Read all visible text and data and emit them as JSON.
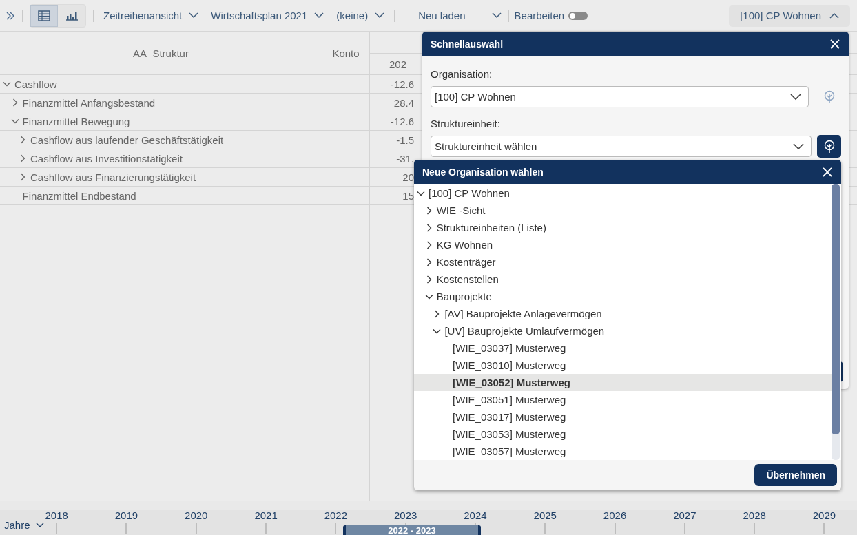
{
  "toolbar": {
    "view_toggles": [
      {
        "kind": "table",
        "selected": true
      },
      {
        "kind": "chart",
        "selected": false
      }
    ],
    "dropdowns": [
      {
        "label": "Zeitreihenansicht"
      },
      {
        "label": "Wirtschaftsplan 2021"
      },
      {
        "label": "(keine)"
      }
    ],
    "reload_button": {
      "label": "Neu laden"
    },
    "edit_toggle": {
      "label": "Bearbeiten",
      "on": false
    },
    "organisation_button": {
      "label": "[100] CP Wohnen",
      "expanded": true
    }
  },
  "table": {
    "columns": [
      {
        "label": "AA_Struktur"
      },
      {
        "label": "Konto"
      },
      {
        "sublabel": "202"
      }
    ],
    "rows": [
      {
        "label": "Cashflow",
        "expanded": true,
        "value": "-12.6",
        "children": [
          {
            "label": "Finanzmittel Anfangsbestand",
            "expanded": false,
            "value": "28.4"
          },
          {
            "label": "Finanzmittel Bewegung",
            "expanded": true,
            "value": "-12.6",
            "children": [
              {
                "label": "Cashflow aus laufender Geschäftstätigkeit",
                "expanded": false,
                "value": "-1.5"
              },
              {
                "label": "Cashflow aus Investitionstätigkeit",
                "expanded": false,
                "value": "-31."
              },
              {
                "label": "Cashflow aus Finanzierungstätigkeit",
                "expanded": false,
                "value": "20"
              }
            ]
          },
          {
            "label": "Finanzmittel Endbestand",
            "value": "15"
          }
        ]
      }
    ]
  },
  "quick_select": {
    "title": "Schnellauswahl",
    "organisation": {
      "label": "Organisation:",
      "value": "[100] CP Wohnen",
      "tree_button": {
        "disabled": true
      }
    },
    "structure_unit": {
      "label": "Struktureinheit:",
      "placeholder": "Struktureinheit wählen",
      "tree_button": {
        "disabled": false
      }
    }
  },
  "org_dialog": {
    "title": "Neue Organisation wählen",
    "items": [
      {
        "label": "[100] CP Wohnen",
        "expanded": true,
        "selected": false,
        "children": [
          {
            "label": "WIE -Sicht",
            "expanded": false,
            "selected": false
          },
          {
            "label": "Struktureinheiten (Liste)",
            "expanded": false,
            "selected": false
          },
          {
            "label": "KG Wohnen",
            "expanded": false,
            "selected": false
          },
          {
            "label": "Kostenträger",
            "expanded": false,
            "selected": false
          },
          {
            "label": "Kostenstellen",
            "expanded": false,
            "selected": false
          },
          {
            "label": "Bauprojekte",
            "expanded": true,
            "selected": false,
            "children": [
              {
                "label": "[AV] Bauprojekte Anlagevermögen",
                "expanded": false,
                "selected": false
              },
              {
                "label": "[UV] Bauprojekte Umlaufvermögen",
                "expanded": true,
                "selected": false,
                "children": [
                  {
                    "label": "[WIE_03037] Musterweg",
                    "selected": false
                  },
                  {
                    "label": "[WIE_03010] Musterweg",
                    "selected": false
                  },
                  {
                    "label": "[WIE_03052] Musterweg",
                    "selected": true
                  },
                  {
                    "label": "[WIE_03051] Musterweg",
                    "selected": false
                  },
                  {
                    "label": "[WIE_03017] Musterweg",
                    "selected": false
                  },
                  {
                    "label": "[WIE_03053] Musterweg",
                    "selected": false
                  },
                  {
                    "label": "[WIE_03057] Musterweg",
                    "selected": false
                  }
                ]
              }
            ]
          }
        ]
      }
    ],
    "apply_button": {
      "label": "Übernehmen"
    }
  },
  "timeline": {
    "unit": "Jahre",
    "years": [
      "2018",
      "2019",
      "2020",
      "2021",
      "2022",
      "2023",
      "2024",
      "2025",
      "2026",
      "2027",
      "2028",
      "2029"
    ],
    "selection": {
      "label": "2022 - 2023"
    }
  }
}
